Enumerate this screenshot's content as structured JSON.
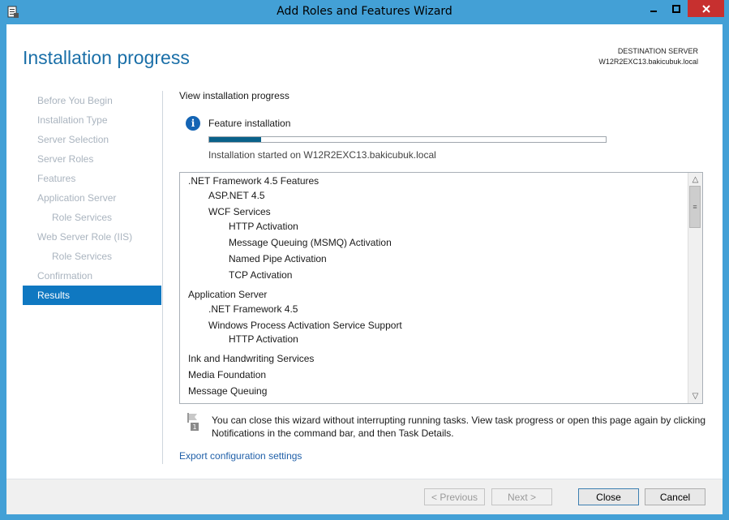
{
  "window": {
    "title": "Add Roles and Features Wizard"
  },
  "header": {
    "page_title": "Installation progress",
    "destination_label": "DESTINATION SERVER",
    "destination_server": "W12R2EXC13.bakicubuk.local"
  },
  "sidebar": {
    "items": [
      {
        "label": "Before You Begin",
        "state": "disabled"
      },
      {
        "label": "Installation Type",
        "state": "disabled"
      },
      {
        "label": "Server Selection",
        "state": "disabled"
      },
      {
        "label": "Server Roles",
        "state": "disabled"
      },
      {
        "label": "Features",
        "state": "disabled"
      },
      {
        "label": "Application Server",
        "state": "disabled"
      },
      {
        "label": "Role Services",
        "state": "disabled",
        "sub": true
      },
      {
        "label": "Web Server Role (IIS)",
        "state": "disabled"
      },
      {
        "label": "Role Services",
        "state": "disabled",
        "sub": true
      },
      {
        "label": "Confirmation",
        "state": "disabled"
      },
      {
        "label": "Results",
        "state": "active"
      }
    ]
  },
  "main": {
    "view_label": "View installation progress",
    "feature_label": "Feature installation",
    "progress": 0.13,
    "started_text": "Installation started on W12R2EXC13.bakicubuk.local",
    "features": [
      {
        "text": ".NET Framework 4.5 Features",
        "level": 0
      },
      {
        "text": "ASP.NET 4.5",
        "level": 1
      },
      {
        "text": "WCF Services",
        "level": 1
      },
      {
        "text": "HTTP Activation",
        "level": 2
      },
      {
        "text": "Message Queuing (MSMQ) Activation",
        "level": 2
      },
      {
        "text": "Named Pipe Activation",
        "level": 2
      },
      {
        "text": "TCP Activation",
        "level": 2
      },
      {
        "text": "Application Server",
        "level": 0
      },
      {
        "text": ".NET Framework 4.5",
        "level": 1
      },
      {
        "text": "Windows Process Activation Service Support",
        "level": 1
      },
      {
        "text": "HTTP Activation",
        "level": 2
      },
      {
        "text": "Ink and Handwriting Services",
        "level": 0
      },
      {
        "text": "Media Foundation",
        "level": 0
      },
      {
        "text": "Message Queuing",
        "level": 0
      }
    ],
    "note_text": "You can close this wizard without interrupting running tasks. View task progress or open this page again by clicking Notifications in the command bar, and then Task Details.",
    "export_link": "Export configuration settings"
  },
  "footer": {
    "previous": "< Previous",
    "next": "Next >",
    "close": "Close",
    "cancel": "Cancel"
  },
  "colors": {
    "accent": "#0f78c1",
    "title_bar": "#43a0d6",
    "progress": "#0a6189",
    "close_button": "#c7302f"
  }
}
